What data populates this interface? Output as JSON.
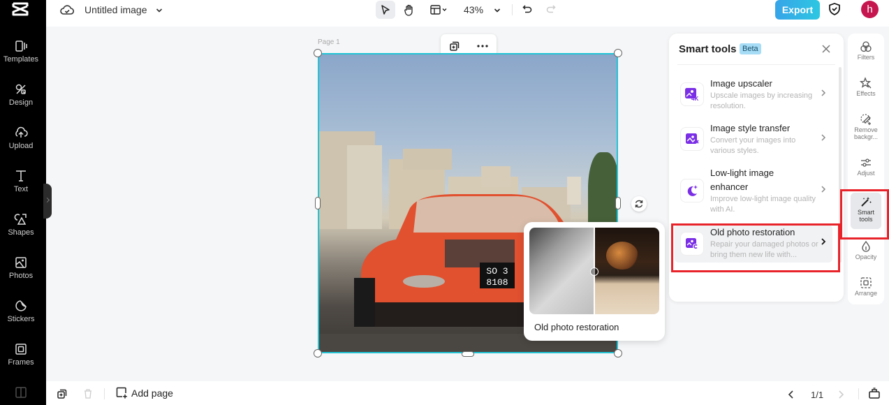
{
  "app": {
    "brand_icon": "capcut-logo-icon"
  },
  "sidebar": {
    "items": [
      {
        "label": "Templates",
        "icon": "templates-icon"
      },
      {
        "label": "Design",
        "icon": "design-icon"
      },
      {
        "label": "Upload",
        "icon": "upload-icon"
      },
      {
        "label": "Text",
        "icon": "text-icon"
      },
      {
        "label": "Shapes",
        "icon": "shapes-icon"
      },
      {
        "label": "Photos",
        "icon": "photos-icon"
      },
      {
        "label": "Stickers",
        "icon": "stickers-icon"
      },
      {
        "label": "Frames",
        "icon": "frames-icon"
      }
    ]
  },
  "header": {
    "title": "Untitled image",
    "zoom": "43%",
    "export_label": "Export",
    "avatar_initial": "h",
    "accent": "#2dc7e2",
    "avatar_color": "#c6164f"
  },
  "canvas": {
    "page_label": "Page 1",
    "plate_line1": "SO 3",
    "plate_line2": "8108"
  },
  "preview": {
    "caption": "Old photo restoration"
  },
  "smart_tools": {
    "title": "Smart tools",
    "badge": "Beta",
    "items": [
      {
        "name": "Image upscaler",
        "desc": "Upscale images by increasing resolution.",
        "icon": "upscale-4k-icon"
      },
      {
        "name": "Image style transfer",
        "desc": "Convert your images into various styles.",
        "icon": "style-transfer-icon"
      },
      {
        "name": "Low-light image enhancer",
        "desc": "Improve low-light image quality with AI.",
        "icon": "moon-sparkle-icon"
      },
      {
        "name": "Old photo restoration",
        "desc": "Repair your damaged photos or bring them new life with...",
        "icon": "photo-restore-icon"
      }
    ],
    "icon_color": "#7a2ee6"
  },
  "right_tools": {
    "items": [
      {
        "label": "Filters"
      },
      {
        "label": "Effects"
      },
      {
        "label": "Remove backgr..."
      },
      {
        "label": "Adjust"
      },
      {
        "label": "Smart tools"
      },
      {
        "label": "Opacity"
      },
      {
        "label": "Arrange"
      }
    ]
  },
  "footer": {
    "add_page_label": "Add page",
    "page_indicator": "1/1"
  }
}
